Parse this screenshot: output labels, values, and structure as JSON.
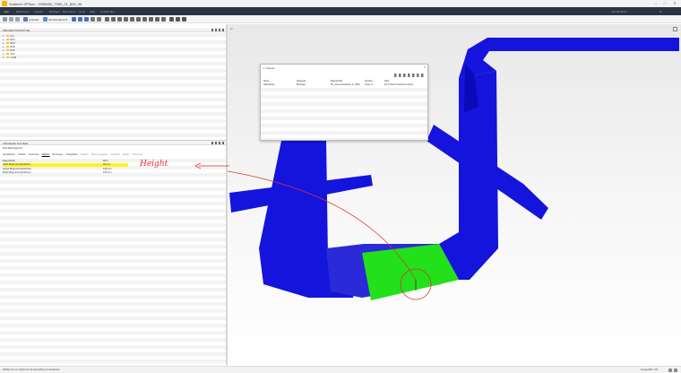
{
  "window": {
    "title": "Sudkirch ZPNux - 2056655_7369_01_800_06"
  },
  "menu": {
    "items": [
      "Start",
      "Bearbeiten",
      "Ansicht",
      "Einfügen",
      "Berechnen",
      "Tools",
      "Hilfe",
      "Ausblenden"
    ],
    "user": "Ein Benutzer"
  },
  "toolbar": {
    "select_label": "Auswahl",
    "view_label": "3D Rundansicht"
  },
  "tree_panel": {
    "title": "PROJEKTSTRUKTUR",
    "items": [
      "rlsn",
      "BO1",
      "BO2",
      "B1B",
      "B1E",
      "T1S",
      "L1GB"
    ]
  },
  "properties_panel": {
    "title": "Individuelle Formfeile",
    "subtitle": "R1S Dehnfugen 10",
    "tabs": [
      "Identifikation",
      "Position",
      "Geometrie",
      "Flächen",
      "Bindungen",
      "Objektfaktor",
      "Statisch",
      "Massenangaben",
      "Vergleich",
      "Details",
      "Toleranzen"
    ],
    "active_tab": "Flächen",
    "columns": {
      "key": "Eigenschaft",
      "value": "Wert"
    },
    "rows": [
      {
        "key": "Höhe Begrenzungsrahmen",
        "value": "99 mm",
        "highlight": true
      },
      {
        "key": "Länge Begrenzungsrahmen",
        "value": "148 mm",
        "highlight": false
      },
      {
        "key": "Breite Begrenzungsrahmen",
        "value": "150 mm",
        "highlight": false
      }
    ]
  },
  "annotation": {
    "text": "Height"
  },
  "dialog": {
    "title": "1 Objekte",
    "columns": [
      "Name",
      "Kategorie",
      "Eigenschaft",
      "Position",
      "Wert"
    ],
    "row": [
      "Dichtelfuse",
      "Befestigt",
      "D1_Innenunterkante_Z_Höhe",
      "Unter ne",
      "D1 H Tiefe Frontal Innenfront"
    ]
  },
  "statusbar": {
    "left": "Wählen Sie ein Objekt für die Darstellung zu bearbeiten",
    "right": "Ausgewählt: 100"
  },
  "colors": {
    "pipe": "#1414dc",
    "selected": "#22e019",
    "highlight": "#fff21f",
    "annotation": "#e23131"
  }
}
